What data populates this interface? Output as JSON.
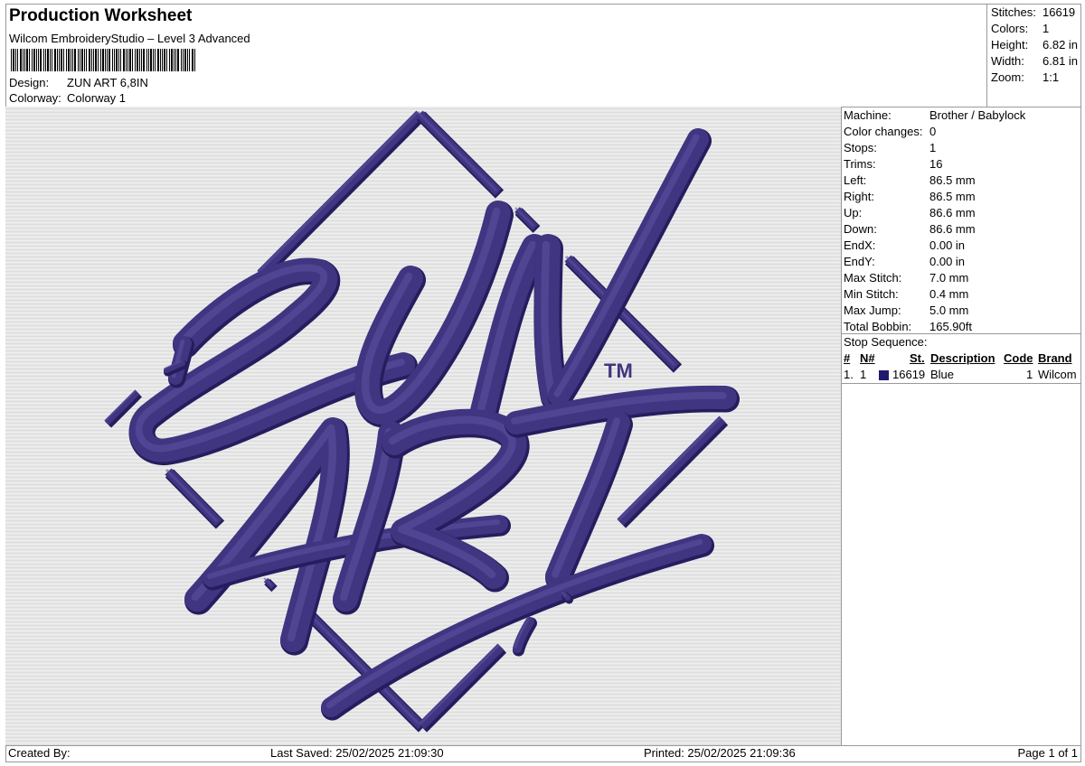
{
  "header": {
    "title": "Production Worksheet",
    "subtitle": "Wilcom EmbroideryStudio – Level 3 Advanced",
    "design_label": "Design:",
    "design_value": "ZUN ART 6,8IN",
    "colorway_label": "Colorway:",
    "colorway_value": "Colorway 1"
  },
  "stats": {
    "stitches_label": "Stitches:",
    "stitches_value": "16619",
    "colors_label": "Colors:",
    "colors_value": "1",
    "height_label": "Height:",
    "height_value": "6.82 in",
    "width_label": "Width:",
    "width_value": "6.81 in",
    "zoom_label": "Zoom:",
    "zoom_value": "1:1"
  },
  "machine_info": {
    "rows": [
      {
        "label": "Machine:",
        "value": "Brother / Babylock"
      },
      {
        "label": "Color changes:",
        "value": "0"
      },
      {
        "label": "Stops:",
        "value": "1"
      },
      {
        "label": "Trims:",
        "value": "16"
      },
      {
        "label": "Left:",
        "value": "86.5 mm"
      },
      {
        "label": "Right:",
        "value": "86.5 mm"
      },
      {
        "label": "Up:",
        "value": "86.6 mm"
      },
      {
        "label": "Down:",
        "value": "86.6 mm"
      },
      {
        "label": "EndX:",
        "value": "0.00 in"
      },
      {
        "label": "EndY:",
        "value": "0.00 in"
      },
      {
        "label": "Max Stitch:",
        "value": "7.0 mm"
      },
      {
        "label": "Min Stitch:",
        "value": "0.4 mm"
      },
      {
        "label": "Max Jump:",
        "value": "5.0 mm"
      },
      {
        "label": "Total Bobbin:",
        "value": "165.90ft"
      }
    ]
  },
  "stop_sequence": {
    "title": "Stop Sequence:",
    "columns": {
      "num": "#",
      "n": "N#",
      "st": "St.",
      "description": "Description",
      "code": "Code",
      "brand": "Brand"
    },
    "rows": [
      {
        "num": "1.",
        "n": "1",
        "st": "16619",
        "description": "Blue",
        "code": "1",
        "brand": "Wilcom",
        "color": "#1f1a6e"
      }
    ]
  },
  "design": {
    "thread_color": "#3f3580",
    "thread_highlight": "#5c52a3",
    "thread_shadow": "#251d5e",
    "trademark": "TM"
  },
  "footer": {
    "created_by": "Created By:",
    "last_saved": "Last Saved: 25/02/2025 21:09:30",
    "printed": "Printed: 25/02/2025 21:09:36",
    "page": "Page 1 of 1"
  }
}
